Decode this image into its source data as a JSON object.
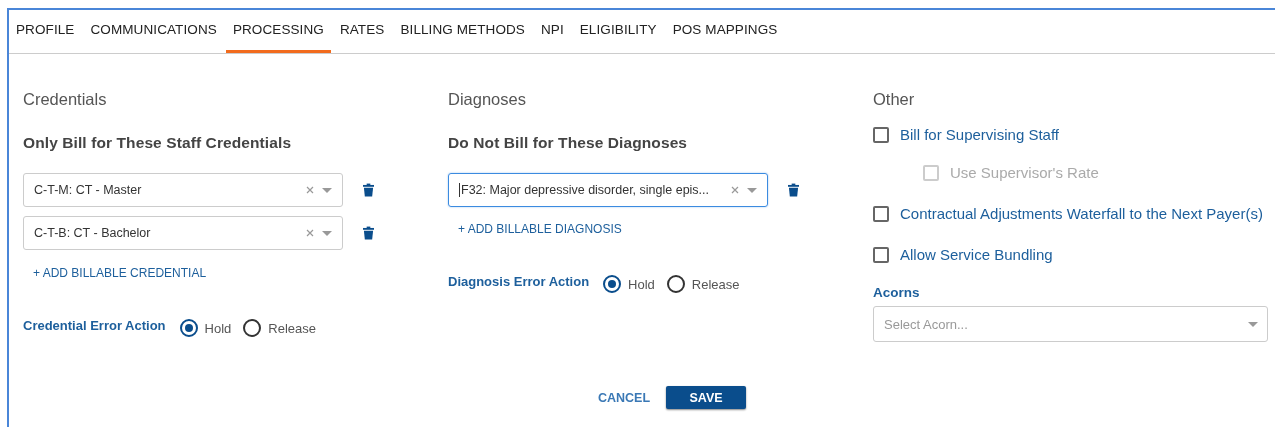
{
  "tabs": [
    {
      "label": "PROFILE",
      "selected": false
    },
    {
      "label": "COMMUNICATIONS",
      "selected": false
    },
    {
      "label": "PROCESSING",
      "selected": true
    },
    {
      "label": "RATES",
      "selected": false
    },
    {
      "label": "BILLING METHODS",
      "selected": false
    },
    {
      "label": "NPI",
      "selected": false
    },
    {
      "label": "ELIGIBILITY",
      "selected": false
    },
    {
      "label": "POS MAPPINGS",
      "selected": false
    }
  ],
  "credentials": {
    "title": "Credentials",
    "subtitle": "Only Bill for These Staff Credentials",
    "items": [
      {
        "value": "C-T-M: CT - Master",
        "focused": false
      },
      {
        "value": "C-T-B: CT - Bachelor",
        "focused": false
      }
    ],
    "add_link": "+ ADD BILLABLE CREDENTIAL",
    "error_action": {
      "label": "Credential Error Action",
      "options": [
        {
          "label": "Hold",
          "selected": true
        },
        {
          "label": "Release",
          "selected": false
        }
      ]
    }
  },
  "diagnoses": {
    "title": "Diagnoses",
    "subtitle": "Do Not Bill for These Diagnoses",
    "items": [
      {
        "value": "F32: Major depressive disorder, single epis...",
        "focused": true
      }
    ],
    "add_link": "+ ADD BILLABLE DIAGNOSIS",
    "error_action": {
      "label": "Diagnosis Error Action",
      "options": [
        {
          "label": "Hold",
          "selected": true
        },
        {
          "label": "Release",
          "selected": false
        }
      ]
    }
  },
  "other": {
    "title": "Other",
    "options": [
      {
        "label": "Bill for Supervising Staff",
        "checked": false,
        "disabled": false,
        "children": [
          {
            "label": "Use Supervisor's Rate",
            "checked": false,
            "disabled": true
          }
        ]
      },
      {
        "label": "Contractual Adjustments Waterfall to the Next Payer(s)",
        "checked": false,
        "disabled": false
      },
      {
        "label": "Allow Service Bundling",
        "checked": false,
        "disabled": false
      }
    ],
    "acorns": {
      "label": "Acorns",
      "placeholder": "Select Acorn..."
    }
  },
  "buttons": [
    {
      "label": "CANCEL",
      "kind": "link"
    },
    {
      "label": "SAVE",
      "kind": "primary"
    }
  ]
}
